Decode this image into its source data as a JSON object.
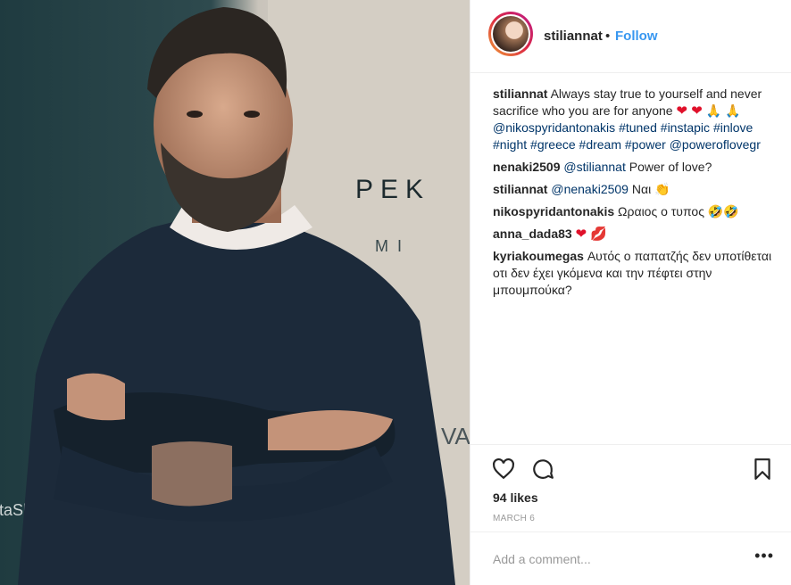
{
  "post": {
    "username": "stiliannat",
    "dot": "•",
    "follow": "Follow",
    "photo_text": {
      "brand_top": "PEK",
      "brand_bottom": "MI",
      "right_text": "VA",
      "left_text": "staShoes"
    }
  },
  "comments": [
    {
      "user": "stiliannat",
      "text": "Always stay true to yourself and never sacrifice who you are for anyone",
      "emoji": "❤ ❤",
      "prayer": "🙏 🙏",
      "mention": "@nikospyridantonakis",
      "tags": [
        "#tuned",
        "#instapic",
        "#inlove",
        "#night",
        "#greece",
        "#dream",
        "#power"
      ],
      "mention2": "@poweroflovegr"
    },
    {
      "user": "nenaki2509",
      "mention": "@stiliannat",
      "text": "Power of love?"
    },
    {
      "user": "stiliannat",
      "mention": "@nenaki2509",
      "text": "Ναι",
      "emoji": "👏"
    },
    {
      "user": "nikospyridantonakis",
      "text": "Ωραιος ο τυπος",
      "emoji": "🤣🤣"
    },
    {
      "user": "anna_dada83",
      "emoji": "❤ 💋"
    },
    {
      "user": "kyriakoumegas",
      "text": "Αυτός ο παπατζής δεν υποτίθεται οτι δεν έχει γκόμενα και την πέφτει στην μπουμπούκα?"
    }
  ],
  "actions": {
    "likes": "94 likes",
    "date": "MARCH 6",
    "add_comment_placeholder": "Add a comment...",
    "more": "•••"
  },
  "icons": [
    "heart-icon",
    "comment-icon",
    "bookmark-icon",
    "more-icon"
  ],
  "colors": {
    "accent": "#3897f0",
    "hashtag": "#003569",
    "meta": "#999999",
    "border": "#efefef"
  }
}
